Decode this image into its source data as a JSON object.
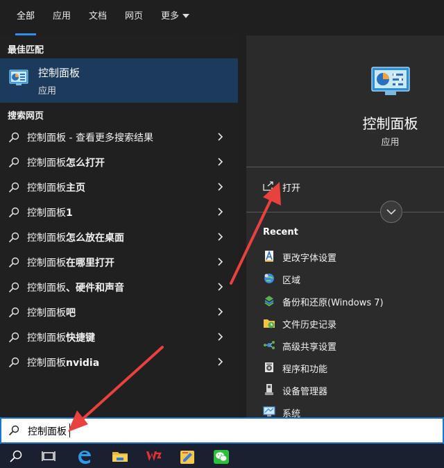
{
  "tabs": [
    {
      "label": "全部",
      "active": true
    },
    {
      "label": "应用"
    },
    {
      "label": "文档"
    },
    {
      "label": "网页"
    },
    {
      "label": "更多"
    }
  ],
  "left": {
    "best_match_title": "最佳匹配",
    "best_match": {
      "name": "控制面板",
      "type": "应用",
      "icon": "control-panel-icon"
    },
    "web_title": "搜索网页",
    "results": [
      {
        "prefix": "控制面板",
        "bold": "",
        "suffix": " - 查看更多搜索结果"
      },
      {
        "prefix": "控制面板",
        "bold": "怎么打开",
        "suffix": ""
      },
      {
        "prefix": "控制面板",
        "bold": "主页",
        "suffix": ""
      },
      {
        "prefix": "控制面板",
        "bold": "1",
        "suffix": ""
      },
      {
        "prefix": "控制面板",
        "bold": "怎么放在桌面",
        "suffix": ""
      },
      {
        "prefix": "控制面板",
        "bold": "在哪里打开",
        "suffix": ""
      },
      {
        "prefix": "控制面板",
        "bold": "、硬件和声音",
        "suffix": ""
      },
      {
        "prefix": "控制面板",
        "bold": "吧",
        "suffix": ""
      },
      {
        "prefix": "控制面板",
        "bold": "快捷键",
        "suffix": ""
      },
      {
        "prefix": "控制面板",
        "bold": "nvidia",
        "suffix": ""
      }
    ]
  },
  "right": {
    "app_title": "控制面板",
    "app_type": "应用",
    "open_label": "打开",
    "recent_title": "Recent",
    "recent": [
      {
        "label": "更改字体设置",
        "icon": "font-icon"
      },
      {
        "label": "区域",
        "icon": "region-icon"
      },
      {
        "label": "备份和还原(Windows 7)",
        "icon": "backup-icon"
      },
      {
        "label": "文件历史记录",
        "icon": "file-history-icon"
      },
      {
        "label": "高级共享设置",
        "icon": "sharing-icon"
      },
      {
        "label": "程序和功能",
        "icon": "programs-icon"
      },
      {
        "label": "设备管理器",
        "icon": "device-manager-icon"
      },
      {
        "label": "系统",
        "icon": "system-icon"
      }
    ]
  },
  "search": {
    "value": "控制面板"
  },
  "taskbar": [
    "search-icon",
    "task-view-icon",
    "edge-icon",
    "file-explorer-icon",
    "wps-icon",
    "notes-icon",
    "wechat-icon"
  ],
  "colors": {
    "accent": "#2f8df5",
    "selected_bg": "#1b3a5c",
    "arrow": "#e8413e"
  }
}
